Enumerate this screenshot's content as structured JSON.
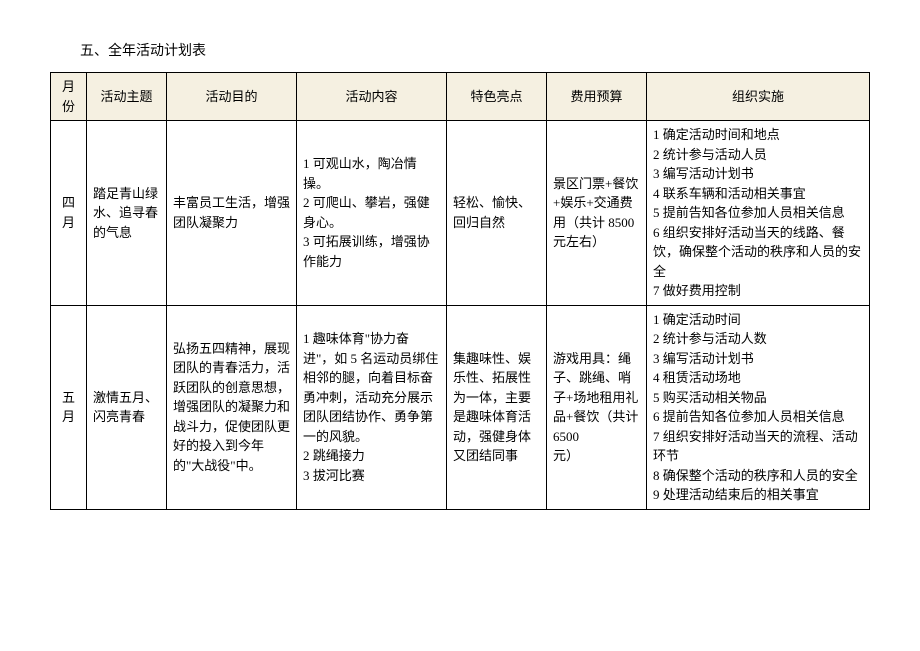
{
  "section_title": "五、全年活动计划表",
  "headers": {
    "month": "月份",
    "theme": "活动主题",
    "purpose": "活动目的",
    "content": "活动内容",
    "highlight": "特色亮点",
    "budget": "费用预算",
    "implementation": "组织实施"
  },
  "rows": [
    {
      "month": "四月",
      "theme": "踏足青山绿水、追寻春的气息",
      "purpose": "丰富员工生活，增强团队凝聚力",
      "content": "1 可观山水，陶冶情操。\n2 可爬山、攀岩，强健身心。\n3 可拓展训练，增强协作能力",
      "highlight": "轻松、愉快、回归自然",
      "budget": "景区门票+餐饮+娱乐+交通费用（共计 8500 元左右）",
      "implementation": "1 确定活动时间和地点\n2 统计参与活动人员\n3 编写活动计划书\n4 联系车辆和活动相关事宜\n5 提前告知各位参加人员相关信息\n6 组织安排好活动当天的线路、餐饮，确保整个活动的秩序和人员的安全\n7 做好费用控制"
    },
    {
      "month": "五月",
      "theme": "激情五月、闪亮青春",
      "purpose": "弘扬五四精神，展现团队的青春活力，活跃团队的创意思想，增强团队的凝聚力和战斗力，促使团队更好的投入到今年的\"大战役\"中。",
      "content": "1 趣味体育\"协力奋进\"，如 5 名运动员绑住相邻的腿，向着目标奋勇冲刺，活动充分展示团队团结协作、勇争第一的风貌。\n2 跳绳接力\n3 拔河比赛",
      "highlight": "集趣味性、娱乐性、拓展性为一体，主要是趣味体育活动，强健身体又团结同事",
      "budget": " 游戏用具：绳子、跳绳、哨子+场地租用礼品+餐饮（共计6500\n元）",
      "implementation": "1 确定活动时间\n2 统计参与活动人数\n3 编写活动计划书\n4 租赁活动场地\n5 购买活动相关物品\n6 提前告知各位参加人员相关信息\n7 组织安排好活动当天的流程、活动环节\n8 确保整个活动的秩序和人员的安全\n9 处理活动结束后的相关事宜"
    }
  ]
}
